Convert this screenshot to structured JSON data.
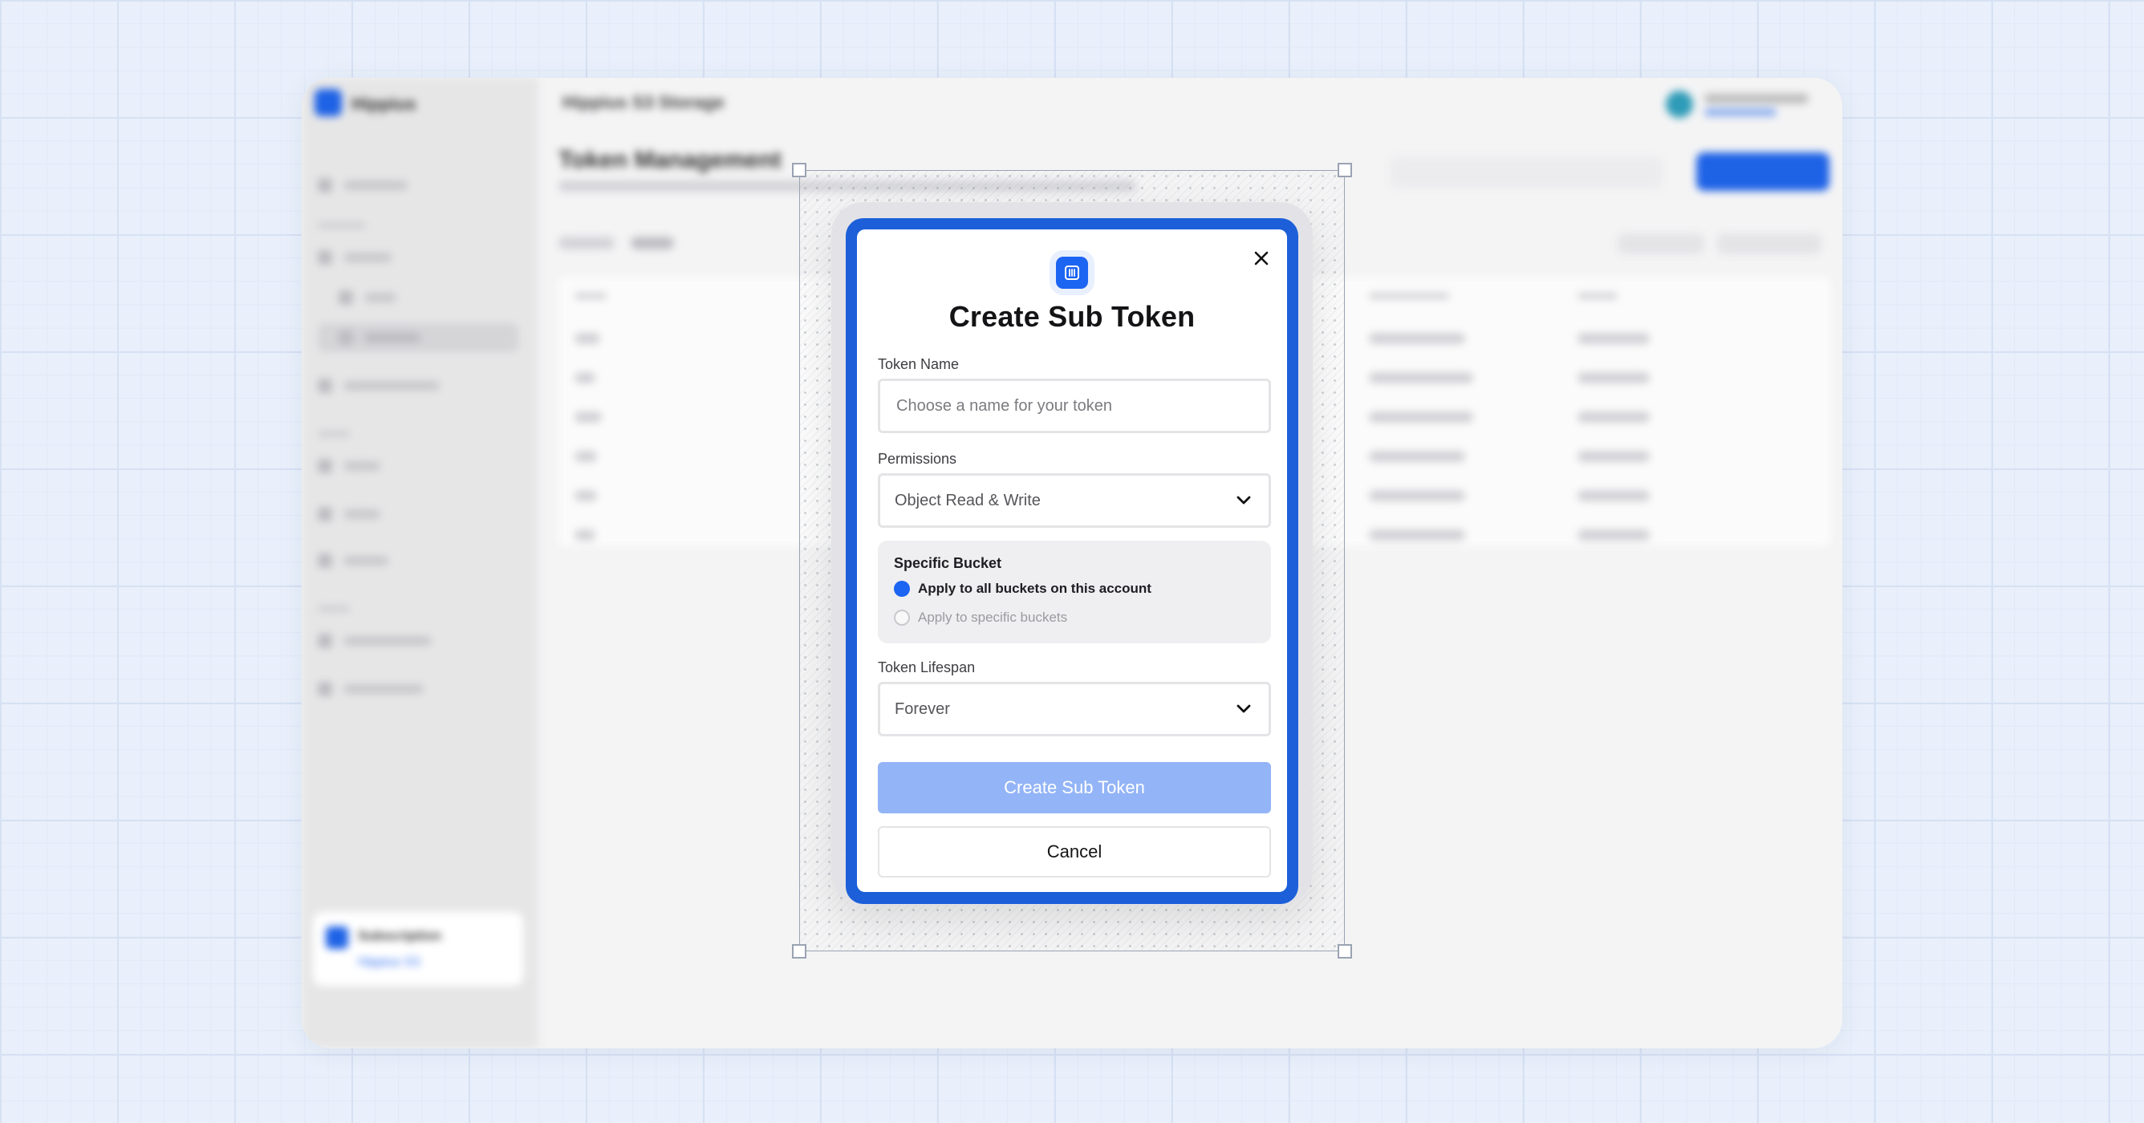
{
  "background_app": {
    "brand": "Hippius",
    "window_title": "Hippius S3 Storage",
    "page_title": "Token Management",
    "promo_title": "Subscription",
    "promo_link": "Hippius S3"
  },
  "modal": {
    "title": "Create Sub Token",
    "icon": "bucket-icon",
    "close_icon": "close-icon",
    "token_name": {
      "label": "Token Name",
      "placeholder": "Choose a name for your token",
      "value": ""
    },
    "permissions": {
      "label": "Permissions",
      "selected": "Object Read & Write"
    },
    "specific_bucket": {
      "title": "Specific Bucket",
      "options": [
        {
          "label": "Apply to all buckets on this account",
          "selected": true
        },
        {
          "label": "Apply to specific buckets",
          "selected": false
        }
      ]
    },
    "token_lifespan": {
      "label": "Token Lifespan",
      "selected": "Forever"
    },
    "primary_button": "Create Sub Token",
    "secondary_button": "Cancel"
  },
  "colors": {
    "accent": "#1c64f2",
    "modal_border": "#1c5fd8",
    "primary_disabled": "#93b4f6",
    "page_background": "#e9f0fb"
  }
}
